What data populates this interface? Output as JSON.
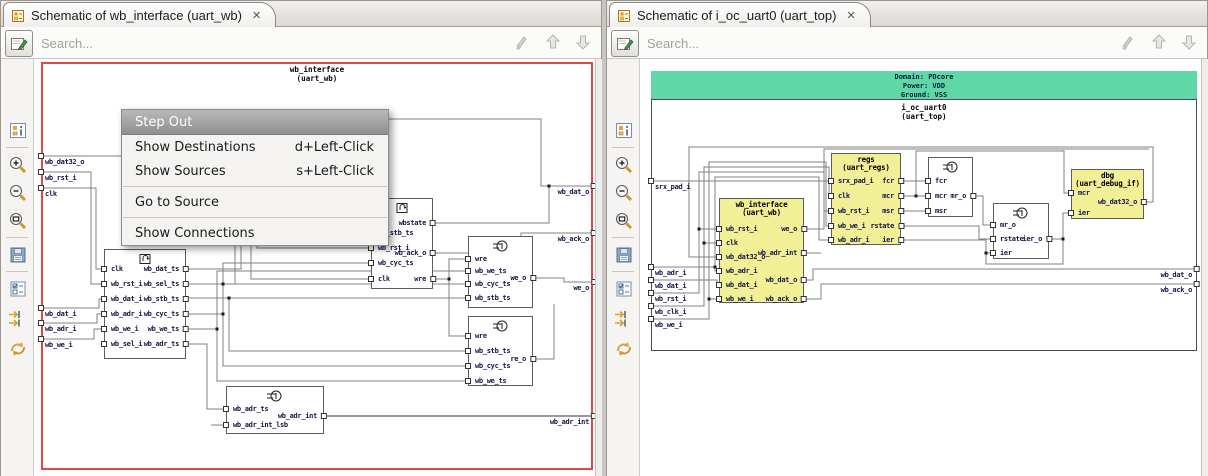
{
  "colors": {
    "red_border": "#e64545",
    "block_yellow": "#f1f096",
    "banner_green": "#5fd7a6",
    "menu_highlight_top": "#b9b9b9"
  },
  "left_panel": {
    "tab_title": "Schematic of wb_interface (uart_wb)",
    "tab_close": "✕",
    "search_placeholder": "Search...",
    "side_toolbar_icons": [
      "properties",
      "zoom-in",
      "zoom-out",
      "zoom-fit",
      "save",
      "filters",
      "pin-trace",
      "refresh"
    ],
    "search_toolbar_icons": [
      "new-schematic-view",
      "clear",
      "previous",
      "next"
    ],
    "schematic": {
      "title": "wb_interface",
      "subtitle": "(uart_wb)",
      "edge_left_top": [
        "wb_dat32_o",
        "wb_rst_i",
        "clk"
      ],
      "edge_left_bottom": [
        "wb_dat_i",
        "wb_adr_i",
        "wb_we_i"
      ],
      "edge_right": [
        "wb_dat_o",
        "wb_ack_o",
        "we_o",
        "wb_adr_int"
      ],
      "reg_block_1": {
        "lports": [
          "clk",
          "wb_rst_i",
          "wb_dat_i",
          "wb_adr_i",
          "wb_we_i",
          "wb_sel_i"
        ],
        "rports": [
          "wb_dat_ts",
          "wb_sel_ts",
          "wb_stb_ts",
          "wb_cyc_ts",
          "wb_we_ts",
          "wb_adr_ts"
        ]
      },
      "reg_block_2": {
        "lports": [
          "wb_stb_ts",
          "wb_rst_i",
          "wb_cyc_ts",
          "clk"
        ],
        "rports": [
          "wbstate",
          "wb_ack_o",
          "wre"
        ]
      },
      "gate_block_a": {
        "lports": [
          "wre",
          "wb_we_ts",
          "wb_cyc_ts",
          "wb_stb_ts"
        ],
        "rports": [
          "we_o"
        ]
      },
      "gate_block_b": {
        "lports": [
          "wre",
          "wb_stb_ts",
          "wb_cyc_ts",
          "wb_we_ts"
        ],
        "rports": [
          "re_o"
        ]
      },
      "gate_block_c": {
        "lports": [
          "wb_adr_ts",
          "wb_adr_int_lsb"
        ],
        "rports": [
          "wb_adr_int"
        ]
      }
    },
    "context_menu": {
      "items": [
        {
          "label": "Step Out",
          "shortcut": ""
        },
        {
          "label": "Show Destinations",
          "shortcut": "d+Left-Click"
        },
        {
          "label": "Show Sources",
          "shortcut": "s+Left-Click"
        },
        {
          "label": "Go to Source",
          "shortcut": ""
        },
        {
          "label": "Show Connections",
          "shortcut": ""
        }
      ]
    }
  },
  "right_panel": {
    "tab_title": "Schematic of i_oc_uart0 (uart_top)",
    "tab_close": "✕",
    "search_placeholder": "Search...",
    "schematic": {
      "banner": {
        "domain": "Domain: PDcore",
        "power": "Power: VDD",
        "ground": "Ground: VSS"
      },
      "instance": "i_oc_uart0",
      "instance_type": "(uart_top)",
      "edge_left": [
        "srx_pad_i",
        "wb_adr_i",
        "wb_dat_i",
        "wb_rst_i",
        "wb_clk_i",
        "wb_we_i"
      ],
      "edge_right": [
        "wb_dat_o",
        "wb_ack_o"
      ],
      "wb_interface": {
        "title": "wb_interface",
        "subtitle": "(uart_wb)",
        "lports": [
          "wb_rst_i",
          "clk",
          "wb_dat32_o",
          "wb_adr_i",
          "wb_dat_i",
          "wb_we_i"
        ],
        "rports": [
          "we_o",
          "wb_adr_int",
          "wb_dat_o",
          "wb_ack_o"
        ]
      },
      "regs": {
        "title": "regs",
        "subtitle": "(uart_regs)",
        "lports": [
          "srx_pad_i",
          "clk",
          "wb_rst_i",
          "wb_we_i",
          "wb_adr_i"
        ],
        "rports": [
          "fcr",
          "mcr",
          "msr",
          "rstate",
          "ier"
        ]
      },
      "gate_1": {
        "lports": [
          "fcr",
          "mcr",
          "msr"
        ],
        "rports": [
          "mr_o"
        ]
      },
      "gate_2": {
        "lports": [
          "mr_o",
          "rstate",
          "ier"
        ],
        "rports": [
          "ier_o"
        ]
      },
      "dbg": {
        "title": "dbg",
        "subtitle": "(uart_debug_if)",
        "lports": [
          "mcr",
          "ier"
        ],
        "rports": [
          "wb_dat32_o"
        ]
      }
    }
  }
}
